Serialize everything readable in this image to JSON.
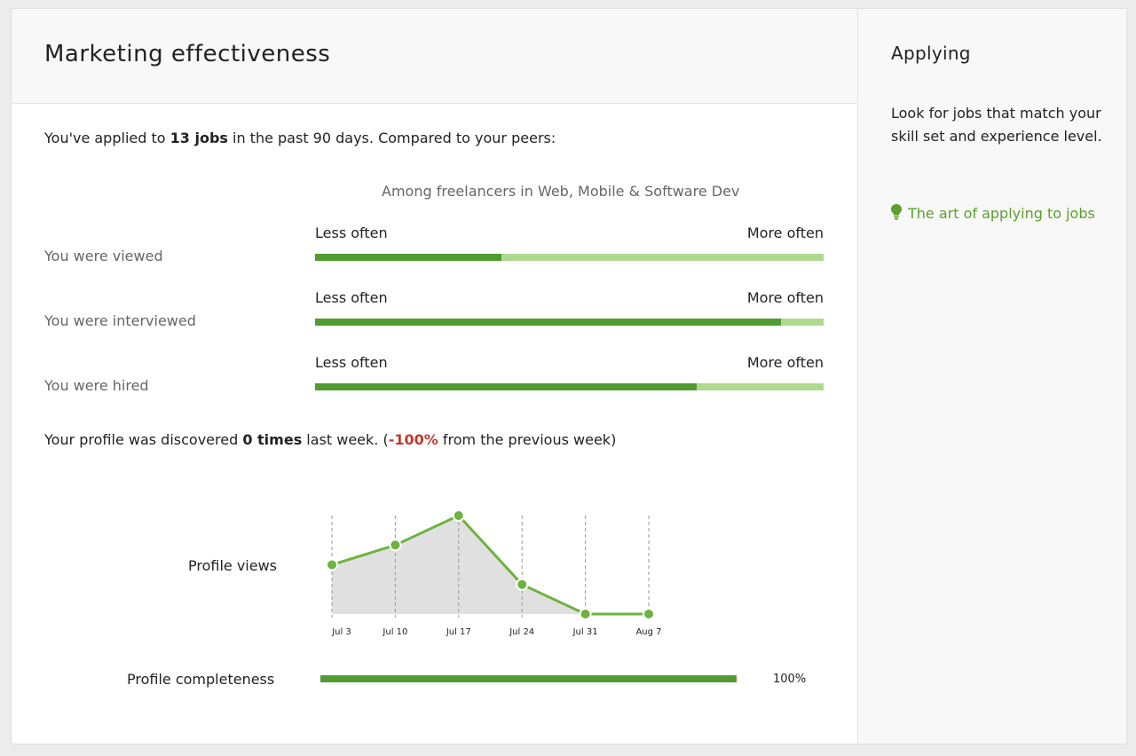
{
  "header": {
    "title": "Marketing effectiveness"
  },
  "summary": {
    "prefix": "You've applied to ",
    "jobs": "13 jobs",
    "suffix": " in the past 90 days. Compared to your peers:"
  },
  "peers": {
    "heading": "Among freelancers in Web, Mobile & Software Dev",
    "less_label": "Less often",
    "more_label": "More often",
    "metrics": [
      {
        "label": "You were viewed",
        "fraction": 0.366
      },
      {
        "label": "You were interviewed",
        "fraction": 0.916
      },
      {
        "label": "You were hired",
        "fraction": 0.75
      }
    ]
  },
  "discovery": {
    "prefix": "Your profile was discovered ",
    "count": "0 times",
    "mid": " last week. (",
    "change": "-100%",
    "suffix": " from the previous week)"
  },
  "chart_data": {
    "type": "area",
    "title": "",
    "series_label": "Profile views",
    "categories": [
      "Jul 3",
      "Jul 10",
      "Jul 17",
      "Jul 24",
      "Jul 31",
      "Aug 7"
    ],
    "values": [
      5,
      7,
      10,
      3,
      0,
      0
    ],
    "ylim": [
      0,
      10
    ],
    "grid": "vertical-dashed",
    "colors": {
      "line": "#6db33f",
      "area": "#e0e0e0",
      "grid": "#999999"
    }
  },
  "completeness": {
    "label": "Profile completeness",
    "value": "100%",
    "fraction": 1.0
  },
  "sidebar": {
    "title": "Applying",
    "description": "Look for jobs that match your skill set and experience level.",
    "link_label": "The art of applying to jobs",
    "link_icon": "lightbulb-icon"
  },
  "colors": {
    "accent": "#5aa02c",
    "bar_fill": "#519b31",
    "bar_track": "#addb8e",
    "negative": "#c0392b"
  }
}
